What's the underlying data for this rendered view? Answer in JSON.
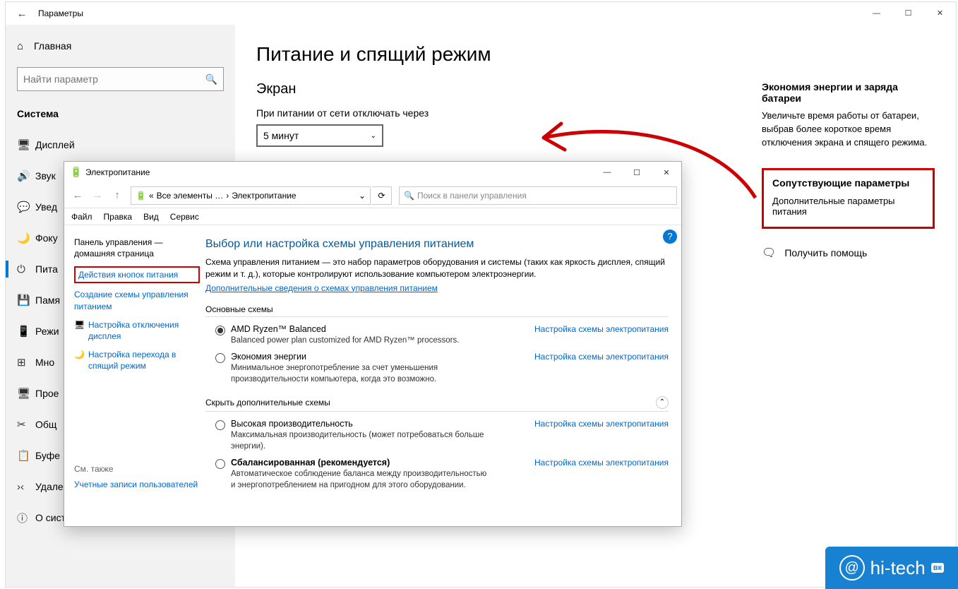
{
  "settings": {
    "title": "Параметры",
    "home": "Главная",
    "search_placeholder": "Найти параметр",
    "category": "Система",
    "nav": [
      {
        "icon": "🖥",
        "label": "Дисплей"
      },
      {
        "icon": "🔊",
        "label": "Звук"
      },
      {
        "icon": "💬",
        "label": "Увед"
      },
      {
        "icon": "🌙",
        "label": "Фоку"
      },
      {
        "icon": "⏻",
        "label": "Пита"
      },
      {
        "icon": "💾",
        "label": "Памя"
      },
      {
        "icon": "📱",
        "label": "Режи"
      },
      {
        "icon": "⊞",
        "label": "Мно"
      },
      {
        "icon": "🖥",
        "label": "Прое"
      },
      {
        "icon": "✂",
        "label": "Общ"
      },
      {
        "icon": "📋",
        "label": "Буфе"
      },
      {
        "icon": "›‹",
        "label": "Удаленный рабочий стол"
      },
      {
        "icon": "ⓘ",
        "label": "О системе"
      }
    ],
    "page_title": "Питание и спящий режим",
    "section_screen": "Экран",
    "field_screen_off": "При питании от сети отключать через",
    "dropdown_value": "5 минут",
    "right": {
      "energy_heading": "Экономия энергии и заряда батареи",
      "energy_body": "Увеличьте время работы от батареи, выбрав более короткое время отключения экрана и спящего режима.",
      "related_heading": "Сопутствующие параметры",
      "related_link": "Дополнительные параметры питания",
      "help": "Получить помощь"
    }
  },
  "cp": {
    "title": "Электропитание",
    "breadcrumb_all": "Все элементы …",
    "breadcrumb_here": "Электропитание",
    "search_placeholder": "Поиск в панели управления",
    "menu": [
      "Файл",
      "Правка",
      "Вид",
      "Сервис"
    ],
    "left": {
      "home": "Панель управления — домашняя страница",
      "l1": "Действия кнопок питания",
      "l2": "Создание схемы управления питанием",
      "l3": "Настройка отключения дисплея",
      "l4": "Настройка перехода в спящий режим",
      "see_also": "См. также",
      "accounts": "Учетные записи пользователей"
    },
    "main": {
      "heading": "Выбор или настройка схемы управления питанием",
      "desc": "Схема управления питанием — это набор параметров оборудования и системы (таких как яркость дисплея, спящий режим и т. д.), которые контролируют использование компьютером электроэнергии.",
      "more": "Дополнительные сведения о схемах управления питанием",
      "group_main": "Основные схемы",
      "configure": "Настройка схемы электропитания",
      "plans_main": [
        {
          "name": "AMD Ryzen™ Balanced",
          "desc": "Balanced power plan customized for AMD Ryzen™ processors.",
          "selected": true
        },
        {
          "name": "Экономия энергии",
          "desc": "Минимальное энергопотребление за счет уменьшения производительности компьютера, когда это возможно.",
          "selected": false
        }
      ],
      "group_extra": "Скрыть дополнительные схемы",
      "plans_extra": [
        {
          "name": "Высокая производительность",
          "desc": "Максимальная производительность (может потребоваться больше энергии).",
          "selected": false,
          "bold": false
        },
        {
          "name": "Сбалансированная (рекомендуется)",
          "desc": "Автоматическое соблюдение баланса между производительностью и энергопотреблением на пригодном для этого оборудовании.",
          "selected": false,
          "bold": true
        }
      ]
    }
  },
  "watermark": "hi-tech"
}
